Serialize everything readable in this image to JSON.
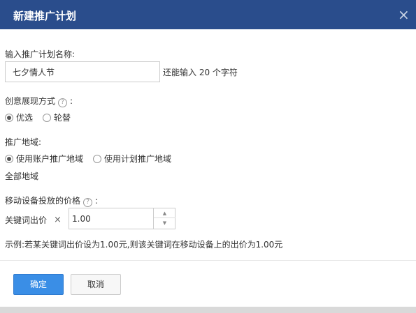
{
  "dialog": {
    "title": "新建推广计划",
    "close_icon": "×"
  },
  "plan_name": {
    "label": "输入推广计划名称:",
    "value": "七夕情人节",
    "hint": "还能输入 20 个字符"
  },
  "display_mode": {
    "label": "创意展现方式",
    "help": "?",
    "colon": ":",
    "options": [
      {
        "label": "优选",
        "selected": true
      },
      {
        "label": "轮替",
        "selected": false
      }
    ]
  },
  "region": {
    "label": "推广地域:",
    "options": [
      {
        "label": "使用账户推广地域",
        "selected": true
      },
      {
        "label": "使用计划推广地域",
        "selected": false
      }
    ],
    "value": "全部地域"
  },
  "mobile_price": {
    "label": "移动设备投放的价格",
    "help": "?",
    "colon": ":",
    "bid_label": "关键词出价",
    "times": "×",
    "value": "1.00",
    "spin_up": "▲",
    "spin_down": "▼",
    "example": "示例:若某关键词出价设为1.00元,则该关键词在移动设备上的出价为1.00元"
  },
  "buttons": {
    "ok": "确定",
    "cancel": "取消"
  }
}
